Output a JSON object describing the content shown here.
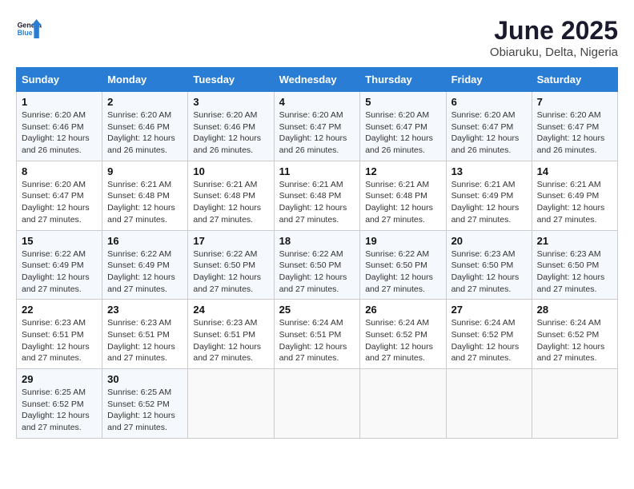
{
  "header": {
    "logo_general": "General",
    "logo_blue": "Blue",
    "month_year": "June 2025",
    "location": "Obiaruku, Delta, Nigeria"
  },
  "days_of_week": [
    "Sunday",
    "Monday",
    "Tuesday",
    "Wednesday",
    "Thursday",
    "Friday",
    "Saturday"
  ],
  "weeks": [
    [
      {
        "day": "1",
        "sunrise": "6:20 AM",
        "sunset": "6:46 PM",
        "daylight": "12 hours and 26 minutes."
      },
      {
        "day": "2",
        "sunrise": "6:20 AM",
        "sunset": "6:46 PM",
        "daylight": "12 hours and 26 minutes."
      },
      {
        "day": "3",
        "sunrise": "6:20 AM",
        "sunset": "6:46 PM",
        "daylight": "12 hours and 26 minutes."
      },
      {
        "day": "4",
        "sunrise": "6:20 AM",
        "sunset": "6:47 PM",
        "daylight": "12 hours and 26 minutes."
      },
      {
        "day": "5",
        "sunrise": "6:20 AM",
        "sunset": "6:47 PM",
        "daylight": "12 hours and 26 minutes."
      },
      {
        "day": "6",
        "sunrise": "6:20 AM",
        "sunset": "6:47 PM",
        "daylight": "12 hours and 26 minutes."
      },
      {
        "day": "7",
        "sunrise": "6:20 AM",
        "sunset": "6:47 PM",
        "daylight": "12 hours and 26 minutes."
      }
    ],
    [
      {
        "day": "8",
        "sunrise": "6:20 AM",
        "sunset": "6:47 PM",
        "daylight": "12 hours and 27 minutes."
      },
      {
        "day": "9",
        "sunrise": "6:21 AM",
        "sunset": "6:48 PM",
        "daylight": "12 hours and 27 minutes."
      },
      {
        "day": "10",
        "sunrise": "6:21 AM",
        "sunset": "6:48 PM",
        "daylight": "12 hours and 27 minutes."
      },
      {
        "day": "11",
        "sunrise": "6:21 AM",
        "sunset": "6:48 PM",
        "daylight": "12 hours and 27 minutes."
      },
      {
        "day": "12",
        "sunrise": "6:21 AM",
        "sunset": "6:48 PM",
        "daylight": "12 hours and 27 minutes."
      },
      {
        "day": "13",
        "sunrise": "6:21 AM",
        "sunset": "6:49 PM",
        "daylight": "12 hours and 27 minutes."
      },
      {
        "day": "14",
        "sunrise": "6:21 AM",
        "sunset": "6:49 PM",
        "daylight": "12 hours and 27 minutes."
      }
    ],
    [
      {
        "day": "15",
        "sunrise": "6:22 AM",
        "sunset": "6:49 PM",
        "daylight": "12 hours and 27 minutes."
      },
      {
        "day": "16",
        "sunrise": "6:22 AM",
        "sunset": "6:49 PM",
        "daylight": "12 hours and 27 minutes."
      },
      {
        "day": "17",
        "sunrise": "6:22 AM",
        "sunset": "6:50 PM",
        "daylight": "12 hours and 27 minutes."
      },
      {
        "day": "18",
        "sunrise": "6:22 AM",
        "sunset": "6:50 PM",
        "daylight": "12 hours and 27 minutes."
      },
      {
        "day": "19",
        "sunrise": "6:22 AM",
        "sunset": "6:50 PM",
        "daylight": "12 hours and 27 minutes."
      },
      {
        "day": "20",
        "sunrise": "6:23 AM",
        "sunset": "6:50 PM",
        "daylight": "12 hours and 27 minutes."
      },
      {
        "day": "21",
        "sunrise": "6:23 AM",
        "sunset": "6:50 PM",
        "daylight": "12 hours and 27 minutes."
      }
    ],
    [
      {
        "day": "22",
        "sunrise": "6:23 AM",
        "sunset": "6:51 PM",
        "daylight": "12 hours and 27 minutes."
      },
      {
        "day": "23",
        "sunrise": "6:23 AM",
        "sunset": "6:51 PM",
        "daylight": "12 hours and 27 minutes."
      },
      {
        "day": "24",
        "sunrise": "6:23 AM",
        "sunset": "6:51 PM",
        "daylight": "12 hours and 27 minutes."
      },
      {
        "day": "25",
        "sunrise": "6:24 AM",
        "sunset": "6:51 PM",
        "daylight": "12 hours and 27 minutes."
      },
      {
        "day": "26",
        "sunrise": "6:24 AM",
        "sunset": "6:52 PM",
        "daylight": "12 hours and 27 minutes."
      },
      {
        "day": "27",
        "sunrise": "6:24 AM",
        "sunset": "6:52 PM",
        "daylight": "12 hours and 27 minutes."
      },
      {
        "day": "28",
        "sunrise": "6:24 AM",
        "sunset": "6:52 PM",
        "daylight": "12 hours and 27 minutes."
      }
    ],
    [
      {
        "day": "29",
        "sunrise": "6:25 AM",
        "sunset": "6:52 PM",
        "daylight": "12 hours and 27 minutes."
      },
      {
        "day": "30",
        "sunrise": "6:25 AM",
        "sunset": "6:52 PM",
        "daylight": "12 hours and 27 minutes."
      },
      null,
      null,
      null,
      null,
      null
    ]
  ],
  "labels": {
    "sunrise": "Sunrise:",
    "sunset": "Sunset:",
    "daylight": "Daylight:"
  }
}
